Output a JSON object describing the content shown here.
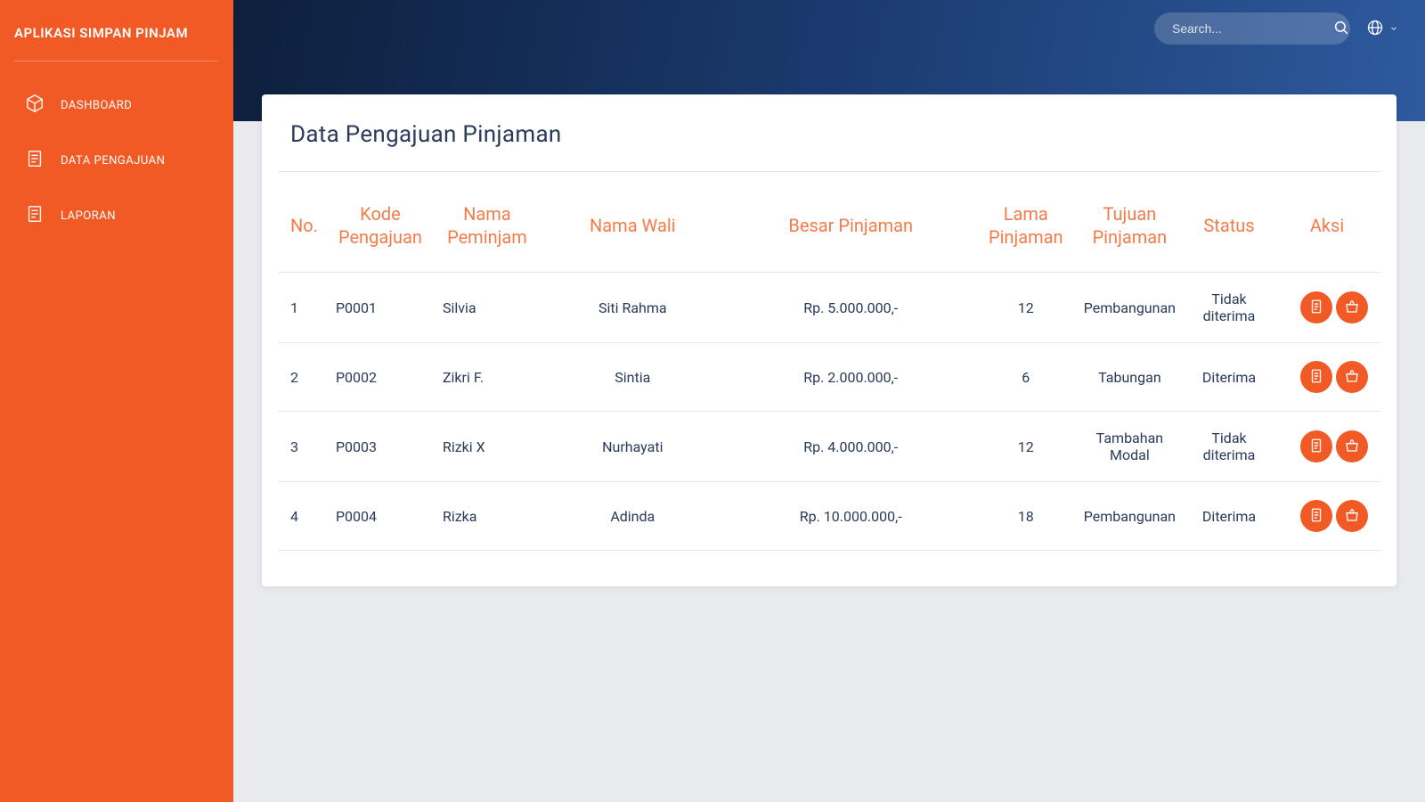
{
  "app": {
    "title": "APLIKASI SIMPAN PINJAM"
  },
  "sidebar": {
    "items": [
      {
        "label": "DASHBOARD"
      },
      {
        "label": "DATA PENGAJUAN"
      },
      {
        "label": "LAPORAN"
      }
    ]
  },
  "header": {
    "search_placeholder": "Search..."
  },
  "page": {
    "title": "Data Pengajuan Pinjaman"
  },
  "table": {
    "headers": {
      "no": "No.",
      "kode": "Kode Pengajuan",
      "nama_peminjam": "Nama Peminjam",
      "nama_wali": "Nama Wali",
      "besar": "Besar Pinjaman",
      "lama": "Lama Pinjaman",
      "tujuan": "Tujuan Pinjaman",
      "status": "Status",
      "aksi": "Aksi"
    },
    "rows": [
      {
        "no": "1",
        "kode": "P0001",
        "nama_peminjam": "Silvia",
        "nama_wali": "Siti Rahma",
        "besar": "Rp. 5.000.000,-",
        "lama": "12",
        "tujuan": "Pembangunan",
        "status": "Tidak diterima"
      },
      {
        "no": "2",
        "kode": "P0002",
        "nama_peminjam": "Zikri F.",
        "nama_wali": "Sintia",
        "besar": "Rp. 2.000.000,-",
        "lama": "6",
        "tujuan": "Tabungan",
        "status": "Diterima"
      },
      {
        "no": "3",
        "kode": "P0003",
        "nama_peminjam": "Rizki X",
        "nama_wali": "Nurhayati",
        "besar": "Rp. 4.000.000,-",
        "lama": "12",
        "tujuan": "Tambahan Modal",
        "status": "Tidak diterima"
      },
      {
        "no": "4",
        "kode": "P0004",
        "nama_peminjam": "Rizka",
        "nama_wali": "Adinda",
        "besar": "Rp. 10.000.000,-",
        "lama": "18",
        "tujuan": "Pembangunan",
        "status": "Diterima"
      }
    ]
  },
  "icons": {
    "dashboard": "cube-icon",
    "data_pengajuan": "document-list-icon",
    "laporan": "document-list-icon",
    "search": "search-icon",
    "globe": "globe-icon",
    "chevron_down": "chevron-down-icon",
    "view": "document-icon",
    "delete": "basket-icon"
  },
  "colors": {
    "accent": "#f15a24",
    "header_text": "#f47c4a",
    "body_text": "#2a3a5a",
    "topbar_start": "#0d1f3c",
    "topbar_end": "#2e5a9e"
  }
}
